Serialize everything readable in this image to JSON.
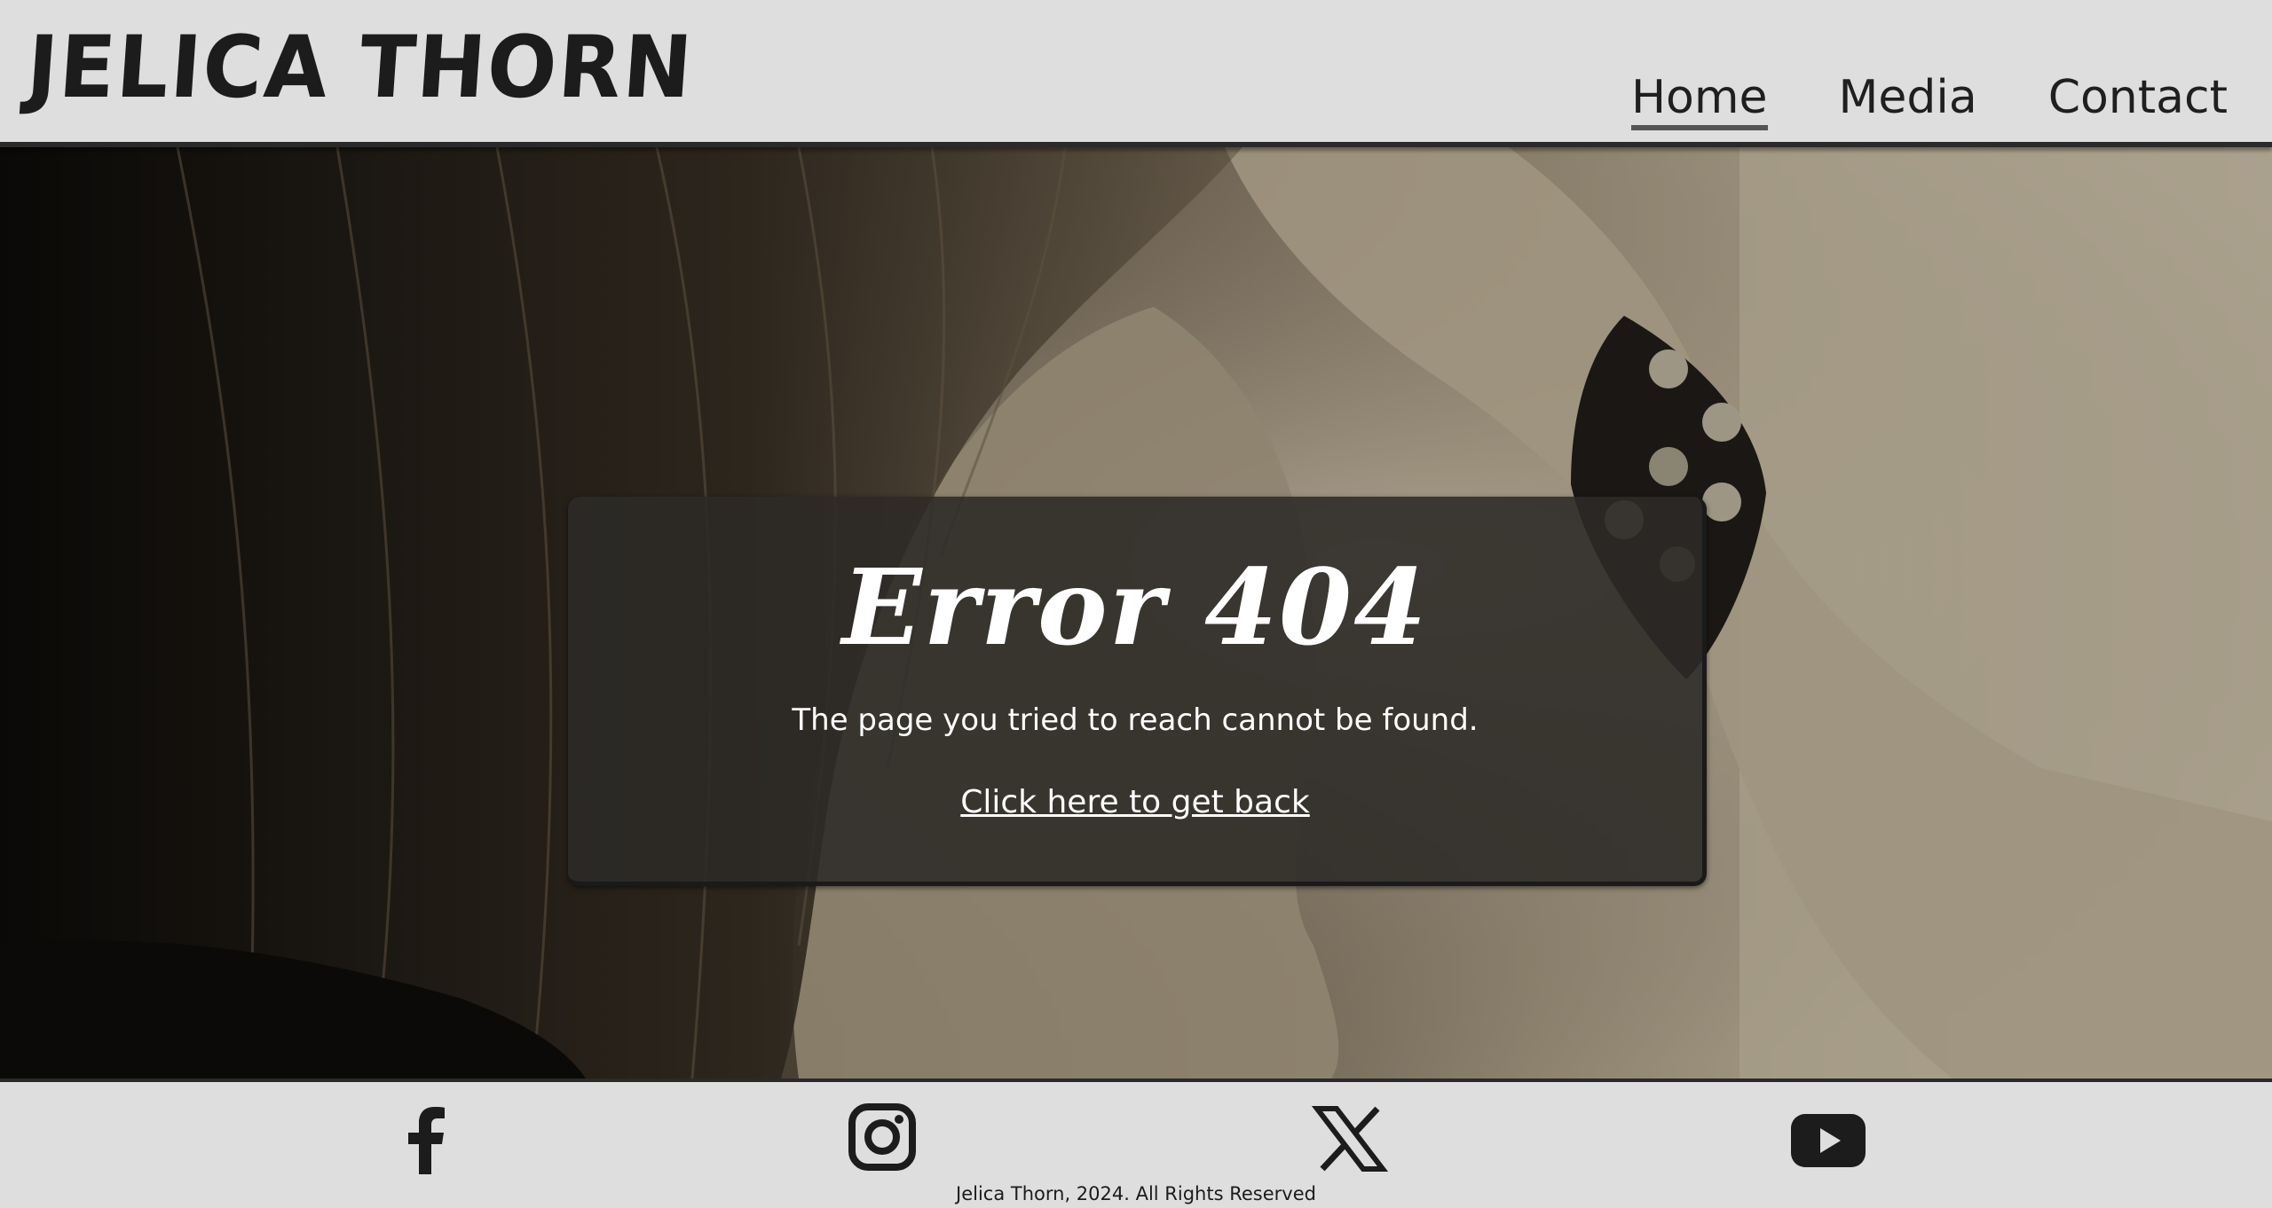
{
  "header": {
    "logo_text": "JELICA THORN",
    "nav": [
      {
        "label": "Home",
        "active": true
      },
      {
        "label": "Media",
        "active": false
      },
      {
        "label": "Contact",
        "active": false
      }
    ]
  },
  "error": {
    "title": "Error 404",
    "message": "The page you tried to reach cannot be found.",
    "back_link": "Click here to get back"
  },
  "footer": {
    "social_icons": [
      "facebook-icon",
      "instagram-icon",
      "x-icon",
      "youtube-icon"
    ],
    "copyright": "Jelica Thorn, 2024. All Rights Reserved"
  },
  "colors": {
    "header_bg": "#dedede",
    "text_dark": "#1c1c1c",
    "card_bg": "#2c2a27",
    "card_text": "#ffffff"
  }
}
